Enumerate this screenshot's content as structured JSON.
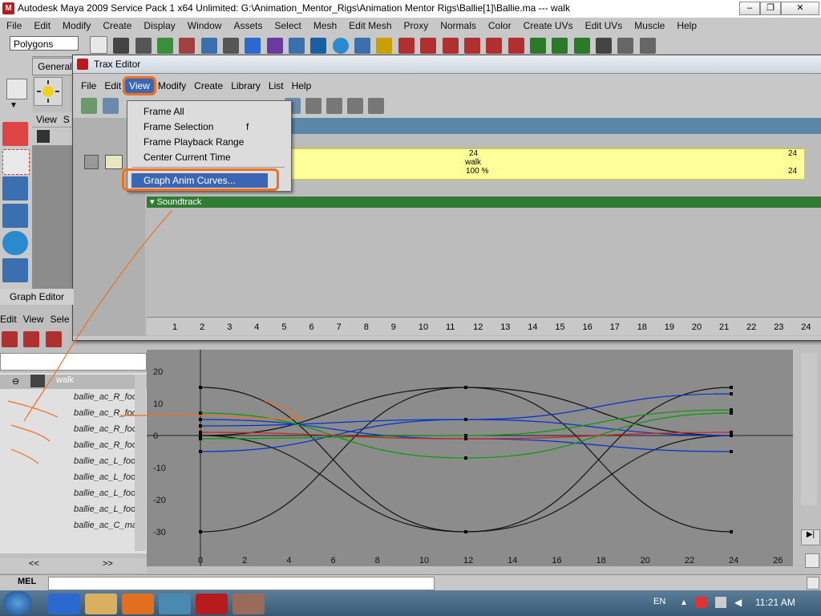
{
  "window_title": "Autodesk Maya 2009 Service Pack 1 x64 Unlimited: G:\\Animation_Mentor_Rigs\\Animation Mentor Rigs\\Ballie[1]\\Ballie.ma   ---   walk",
  "main_menu": [
    "File",
    "Edit",
    "Modify",
    "Create",
    "Display",
    "Window",
    "Assets",
    "Select",
    "Mesh",
    "Edit Mesh",
    "Proxy",
    "Normals",
    "Color",
    "Create UVs",
    "Edit UVs",
    "Muscle",
    "Help"
  ],
  "mode_selector": "Polygons",
  "shelf_tab": "General",
  "view_panel_menu": [
    "View",
    "S"
  ],
  "trax": {
    "title": "Trax Editor",
    "menu": [
      "File",
      "Edit",
      "View",
      "Modify",
      "Create",
      "Library",
      "List",
      "Help"
    ],
    "clip": {
      "start": "24",
      "name": "walk",
      "weight": "100 %",
      "end_top": "24",
      "end_bottom": "24"
    },
    "soundtrack": "Soundtrack",
    "ruler": [
      "1",
      "2",
      "3",
      "4",
      "5",
      "6",
      "7",
      "8",
      "9",
      "10",
      "11",
      "12",
      "13",
      "14",
      "15",
      "16",
      "17",
      "18",
      "19",
      "20",
      "21",
      "22",
      "23",
      "24"
    ]
  },
  "view_menu": {
    "items": [
      "Frame All",
      "Frame Selection",
      "Frame Playback Range",
      "Center Current Time"
    ],
    "frame_selection_shortcut": "f",
    "selected": "Graph Anim Curves..."
  },
  "graph_editor": {
    "title": "Graph Editor",
    "menu": [
      "Edit",
      "View",
      "Sele"
    ],
    "outliner_root": "walk",
    "outliner_items": [
      "ballie_ac_R_foo",
      "ballie_ac_R_foo",
      "ballie_ac_R_foo",
      "ballie_ac_R_foo",
      "ballie_ac_L_foo",
      "ballie_ac_L_foo",
      "ballie_ac_L_foo",
      "ballie_ac_L_foo",
      "ballie_ac_C_ma"
    ],
    "y_labels": [
      "20",
      "10",
      "0",
      "-10",
      "-20",
      "-30"
    ],
    "x_labels": [
      "0",
      "2",
      "4",
      "6",
      "8",
      "10",
      "12",
      "14",
      "16",
      "18",
      "20",
      "22",
      "24",
      "26"
    ],
    "nav": [
      "<<",
      ">>"
    ]
  },
  "command_line_label": "MEL",
  "taskbar": {
    "lang": "EN",
    "time": "11:21 AM"
  },
  "colors": {
    "selection": "#3a66b5",
    "highlight_ring": "#f07020",
    "clip": "#ffff99",
    "soundtrack": "#2e7d32"
  }
}
